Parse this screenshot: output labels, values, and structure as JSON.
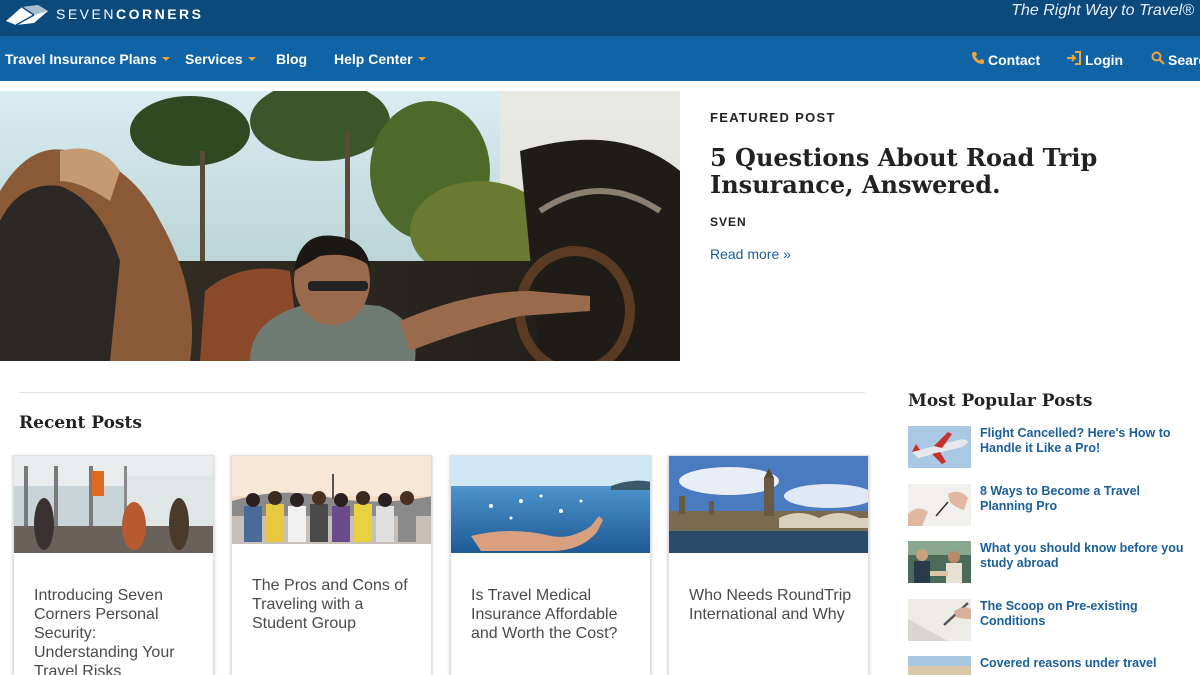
{
  "brand": {
    "name_light": "SEVEN",
    "name_bold": "CORNERS",
    "tagline": "The Right Way to Travel®"
  },
  "nav": {
    "left": [
      {
        "label": "Travel Insurance Plans",
        "dropdown": true
      },
      {
        "label": "Services",
        "dropdown": true
      },
      {
        "label": "Blog",
        "dropdown": false
      },
      {
        "label": "Help Center",
        "dropdown": true
      }
    ],
    "right": [
      {
        "label": "Contact",
        "icon": "phone-icon"
      },
      {
        "label": "Login",
        "icon": "login-icon"
      },
      {
        "label": "Search",
        "icon": "search-icon"
      }
    ]
  },
  "featured": {
    "label": "FEATURED POST",
    "title": "5 Questions About Road Trip Insurance, Answered.",
    "author": "SVEN",
    "read_more": "Read more »",
    "image": "man-driving-convertible-photo"
  },
  "recent": {
    "heading": "Recent Posts",
    "posts": [
      {
        "title": "Introducing Seven Corners Personal Security: Understanding Your Travel Risks",
        "image": "airport-terminal-photo"
      },
      {
        "title": "The Pros and Cons of Traveling with a Student Group",
        "image": "student-group-photo"
      },
      {
        "title": "Is Travel Medical Insurance Affordable and Worth the Cost?",
        "image": "hand-over-water-photo"
      },
      {
        "title": "Who Needs RoundTrip International and Why",
        "image": "london-parliament-photo"
      }
    ]
  },
  "popular": {
    "heading": "Most Popular Posts",
    "posts": [
      {
        "title": "Flight Cancelled? Here's How to Handle it Like a Pro!",
        "image": "airplane-photo"
      },
      {
        "title": "8 Ways to Become a Travel Planning Pro",
        "image": "writing-hand-photo"
      },
      {
        "title": "What you should know before you study abroad",
        "image": "students-photo"
      },
      {
        "title": "The Scoop on Pre-existing Conditions",
        "image": "pen-paper-photo"
      },
      {
        "title": "Covered reasons under travel",
        "image": "beach-photo"
      }
    ]
  },
  "colors": {
    "topbar": "#0c4a7c",
    "navbar": "#1064a6",
    "accent": "#f0a33a",
    "link": "#1a5e9a"
  }
}
